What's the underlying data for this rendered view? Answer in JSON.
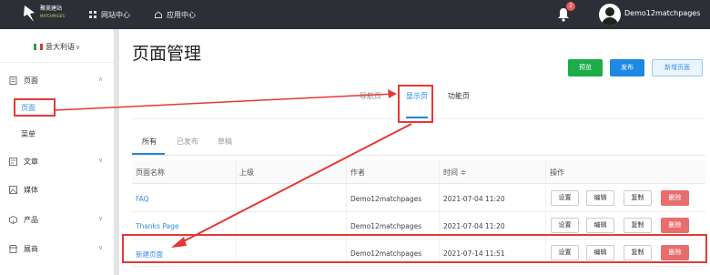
{
  "topbar": {
    "logo_text": "聚美建站",
    "logo_sub": "MATCHPAGES",
    "nav_website": "网站中心",
    "nav_app": "应用中心",
    "notification_count": "2",
    "username": "Demo12matchpages"
  },
  "sidebar": {
    "language": "意大利语",
    "items": [
      {
        "label": "页面",
        "icon": "page-icon"
      },
      {
        "label": "页面",
        "icon": ""
      },
      {
        "label": "菜单",
        "icon": ""
      },
      {
        "label": "文章",
        "icon": "article-icon"
      },
      {
        "label": "媒体",
        "icon": "image-icon"
      },
      {
        "label": "产品",
        "icon": "box-icon"
      },
      {
        "label": "展商",
        "icon": "store-icon"
      }
    ]
  },
  "main": {
    "title": "页面管理",
    "buttons": {
      "preview": "预览",
      "publish": "发布",
      "new_page": "新增页面"
    },
    "tabs": [
      "导航页",
      "显示页",
      "功能页"
    ],
    "active_tab": "显示页",
    "subtabs": [
      "所有",
      "已发布",
      "草稿"
    ],
    "table": {
      "headers": [
        "页面名称",
        "上级",
        "作者",
        "时间 ≑",
        "操作"
      ],
      "rows": [
        {
          "name": "FAQ",
          "parent": "",
          "author": "Demo12matchpages",
          "time": "2021-07-04 11:20"
        },
        {
          "name": "Thanks Page",
          "parent": "",
          "author": "Demo12matchpages",
          "time": "2021-07-04 11:20"
        },
        {
          "name": "新建页面",
          "parent": "",
          "author": "Demo12matchpages",
          "time": "2021-07-14 11:51"
        }
      ],
      "actions": {
        "settings": "设置",
        "edit": "编辑",
        "copy": "复制",
        "delete": "删除"
      }
    }
  },
  "colors": {
    "topbar": "#2c3036",
    "accent": "#1e88e5",
    "success": "#1cac48",
    "danger": "#e86e6e",
    "annotation": "#e53935"
  }
}
